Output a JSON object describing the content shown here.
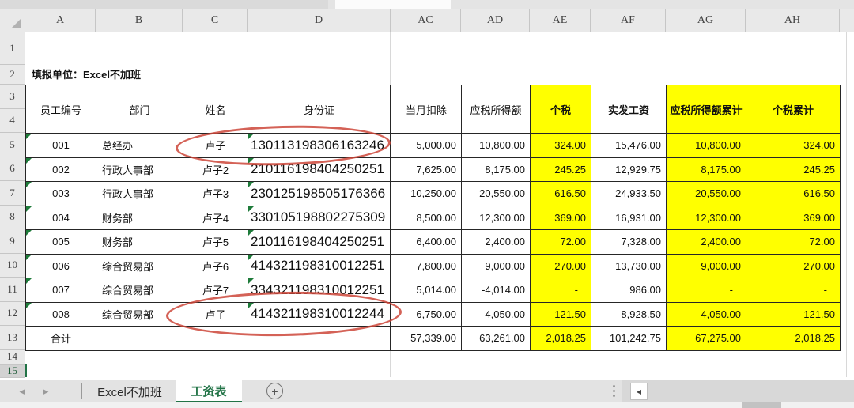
{
  "column_headers": [
    "A",
    "B",
    "C",
    "D",
    "AC",
    "AD",
    "AE",
    "AF",
    "AG",
    "AH"
  ],
  "row_headers": [
    "1",
    "2",
    "3",
    "4",
    "5",
    "6",
    "7",
    "8",
    "9",
    "10",
    "11",
    "12",
    "13",
    "14",
    "15"
  ],
  "title_cell": "填报单位：Excel不加班",
  "table": {
    "columns": [
      {
        "label": "员工编号",
        "highlight": false,
        "bold": false
      },
      {
        "label": "部门",
        "highlight": false,
        "bold": false
      },
      {
        "label": "姓名",
        "highlight": false,
        "bold": false
      },
      {
        "label": "身份证",
        "highlight": false,
        "bold": false
      },
      {
        "label": "当月扣除",
        "highlight": false,
        "bold": false
      },
      {
        "label": "应税所得额",
        "highlight": false,
        "bold": false
      },
      {
        "label": "个税",
        "highlight": true,
        "bold": true
      },
      {
        "label": "实发工资",
        "highlight": false,
        "bold": true
      },
      {
        "label": "应税所得额累计",
        "highlight": true,
        "bold": true
      },
      {
        "label": "个税累计",
        "highlight": true,
        "bold": true
      }
    ],
    "rows": [
      [
        "001",
        "总经办",
        "卢子",
        "130113198306163246",
        "5,000.00",
        "10,800.00",
        "324.00",
        "15,476.00",
        "10,800.00",
        "324.00"
      ],
      [
        "002",
        "行政人事部",
        "卢子2",
        "210116198404250251",
        "7,625.00",
        "8,175.00",
        "245.25",
        "12,929.75",
        "8,175.00",
        "245.25"
      ],
      [
        "003",
        "行政人事部",
        "卢子3",
        "230125198505176366",
        "10,250.00",
        "20,550.00",
        "616.50",
        "24,933.50",
        "20,550.00",
        "616.50"
      ],
      [
        "004",
        "财务部",
        "卢子4",
        "330105198802275309",
        "8,500.00",
        "12,300.00",
        "369.00",
        "16,931.00",
        "12,300.00",
        "369.00"
      ],
      [
        "005",
        "财务部",
        "卢子5",
        "210116198404250251",
        "6,400.00",
        "2,400.00",
        "72.00",
        "7,328.00",
        "2,400.00",
        "72.00"
      ],
      [
        "006",
        "综合贸易部",
        "卢子6",
        "414321198310012251",
        "7,800.00",
        "9,000.00",
        "270.00",
        "13,730.00",
        "9,000.00",
        "270.00"
      ],
      [
        "007",
        "综合贸易部",
        "卢子7",
        "334321198310012251",
        "5,014.00",
        "-4,014.00",
        "-",
        "986.00",
        "-",
        "-"
      ],
      [
        "008",
        "综合贸易部",
        "卢子",
        "414321198310012244",
        "6,750.00",
        "4,050.00",
        "121.50",
        "8,928.50",
        "4,050.00",
        "121.50"
      ]
    ],
    "total_row": [
      "合计",
      "",
      "",
      "",
      "57,339.00",
      "63,261.00",
      "2,018.25",
      "101,242.75",
      "67,275.00",
      "2,018.25"
    ],
    "error_marker_columns": [
      0,
      3
    ]
  },
  "annotations": {
    "red_circles": [
      "row5-name-and-id",
      "row12-name-and-id"
    ]
  },
  "sheet_bar": {
    "nav_left": "◀",
    "nav_right": "▶",
    "tabs": [
      {
        "label": "Excel不加班",
        "active": false
      },
      {
        "label": "工资表",
        "active": true
      }
    ],
    "add_button": "+",
    "scroll_left": "◀"
  },
  "colors": {
    "highlight_yellow": "#FFFF00",
    "tab_green": "#217346",
    "error_green": "#1E7B3A",
    "circle_red": "#CD463A"
  }
}
